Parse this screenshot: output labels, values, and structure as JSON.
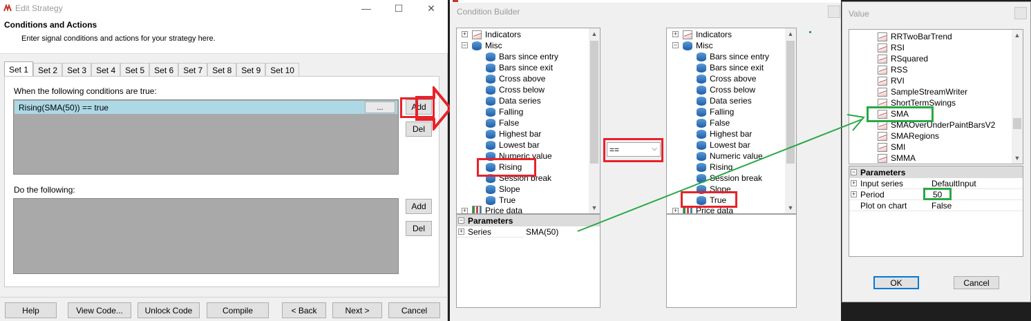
{
  "edit_strategy": {
    "title": "Edit Strategy",
    "heading": "Conditions and Actions",
    "subheading": "Enter signal conditions and actions for your strategy here.",
    "tabs": [
      "Set 1",
      "Set 2",
      "Set 3",
      "Set 4",
      "Set 5",
      "Set 6",
      "Set 7",
      "Set 8",
      "Set 9",
      "Set 10"
    ],
    "active_tab": "Set 1",
    "conditions_label": "When the following conditions are true:",
    "condition_row": "Rising(SMA(50)) == true",
    "ellipsis_label": "...",
    "add_label": "Add",
    "del_label": "Del",
    "actions_label": "Do the following:",
    "footer": {
      "help": "Help",
      "view_code": "View Code...",
      "unlock_code": "Unlock Code",
      "compile": "Compile",
      "back": "< Back",
      "next": "Next >",
      "cancel": "Cancel"
    },
    "window_controls": {
      "minimize": "—",
      "maximize": "☐",
      "close": "✕"
    }
  },
  "condition_builder": {
    "title": "Condition Builder",
    "left_tree": {
      "indicators": "Indicators",
      "misc": "Misc",
      "items": [
        "Bars since entry",
        "Bars since exit",
        "Cross above",
        "Cross below",
        "Data series",
        "Falling",
        "False",
        "Highest bar",
        "Lowest bar",
        "Numeric value",
        "Rising",
        "Session break",
        "Slope",
        "True"
      ],
      "price_data": "Price data"
    },
    "left_params": {
      "header": "Parameters",
      "rows": [
        {
          "name": "Series",
          "value": "SMA(50)"
        }
      ]
    },
    "operator": "==",
    "right_tree": {
      "indicators": "Indicators",
      "misc": "Misc",
      "items": [
        "Bars since entry",
        "Bars since exit",
        "Cross above",
        "Cross below",
        "Data series",
        "Falling",
        "False",
        "Highest bar",
        "Lowest bar",
        "Numeric value",
        "Rising",
        "Session break",
        "Slope",
        "True"
      ],
      "price_data": "Price data"
    }
  },
  "value_window": {
    "title": "Value",
    "items": [
      "RRTwoBarTrend",
      "RSI",
      "RSquared",
      "RSS",
      "RVI",
      "SampleStreamWriter",
      "ShortTermSwings",
      "SMA",
      "SMAOverUnderPaintBarsV2",
      "SMARegions",
      "SMI",
      "SMMA"
    ],
    "params_header": "Parameters",
    "params": [
      {
        "name": "Input series",
        "value": "DefaultInput"
      },
      {
        "name": "Period",
        "value": "50"
      },
      {
        "name": "Plot on chart",
        "value": "False"
      }
    ],
    "ok": "OK",
    "cancel": "Cancel"
  },
  "colors": {
    "highlight_red": "#e8212a",
    "highlight_green": "#27a844",
    "selected_row": "#add8e6",
    "list_background": "#a9a9a9"
  }
}
